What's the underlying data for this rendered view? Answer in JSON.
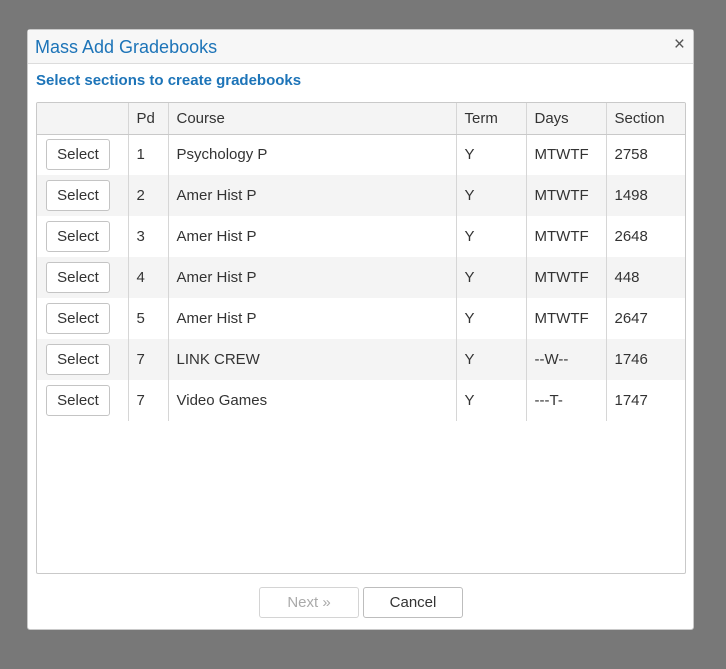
{
  "dialog": {
    "title": "Mass Add Gradebooks",
    "close_icon": "close-icon",
    "close_glyph": "×",
    "subtitle": "Select sections to create gradebooks"
  },
  "table": {
    "headers": [
      "",
      "Pd",
      "Course",
      "Term",
      "Days",
      "Section"
    ],
    "rows": [
      {
        "action": "Select",
        "pd": "1",
        "course": "Psychology P",
        "term": "Y",
        "days": "MTWTF",
        "section": "2758"
      },
      {
        "action": "Select",
        "pd": "2",
        "course": "Amer Hist P",
        "term": "Y",
        "days": "MTWTF",
        "section": "1498"
      },
      {
        "action": "Select",
        "pd": "3",
        "course": "Amer Hist P",
        "term": "Y",
        "days": "MTWTF",
        "section": "2648"
      },
      {
        "action": "Select",
        "pd": "4",
        "course": "Amer Hist P",
        "term": "Y",
        "days": "MTWTF",
        "section": "448"
      },
      {
        "action": "Select",
        "pd": "5",
        "course": "Amer Hist P",
        "term": "Y",
        "days": "MTWTF",
        "section": "2647"
      },
      {
        "action": "Select",
        "pd": "7",
        "course": "LINK CREW",
        "term": "Y",
        "days": "--W--",
        "section": "1746"
      },
      {
        "action": "Select",
        "pd": "7",
        "course": "Video Games",
        "term": "Y",
        "days": "---T-",
        "section": "1747"
      }
    ]
  },
  "footer": {
    "next_label": "Next »",
    "next_disabled": true,
    "cancel_label": "Cancel"
  },
  "colors": {
    "accent": "#1d74b8",
    "backdrop": "#787878"
  }
}
